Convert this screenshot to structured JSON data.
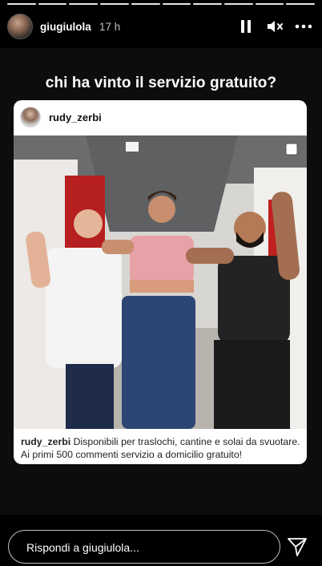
{
  "header": {
    "username": "giugiulola",
    "time": "17 h",
    "icons": [
      "pause-icon",
      "mute-icon",
      "more-icon"
    ]
  },
  "story": {
    "headline": "chi ha vinto il servizio gratuito?",
    "post": {
      "username": "rudy_zerbi",
      "caption_user": "rudy_zerbi",
      "caption_text": "Disponibili per traslochi, cantine e solai da svuotare. Ai primi 500 commenti servizio a domicilio gratuito!"
    }
  },
  "footer": {
    "reply_placeholder": "Rispondi a giugiulola...",
    "send_icon": "send-icon"
  },
  "colors": {
    "background": "#000000",
    "card": "#ffffff"
  }
}
